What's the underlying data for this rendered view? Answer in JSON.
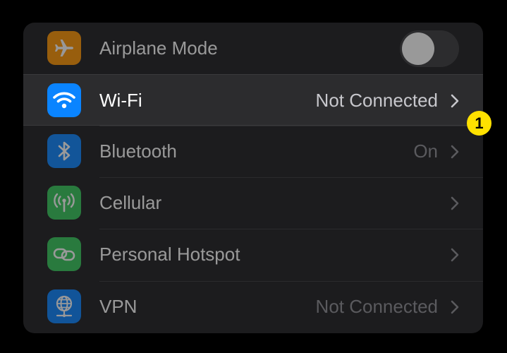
{
  "settings": {
    "rows": [
      {
        "label": "Airplane Mode",
        "icon": "airplane-icon",
        "icon_color": "#ff9500",
        "control": "toggle",
        "toggle_on": false
      },
      {
        "label": "Wi-Fi",
        "icon": "wifi-icon",
        "icon_color": "#0a84ff",
        "value": "Not Connected",
        "control": "chevron"
      },
      {
        "label": "Bluetooth",
        "icon": "bluetooth-icon",
        "icon_color": "#0a84ff",
        "value": "On",
        "control": "chevron"
      },
      {
        "label": "Cellular",
        "icon": "antenna-icon",
        "icon_color": "#34c759",
        "value": "",
        "control": "chevron"
      },
      {
        "label": "Personal Hotspot",
        "icon": "link-icon",
        "icon_color": "#34c759",
        "value": "",
        "control": "chevron"
      },
      {
        "label": "VPN",
        "icon": "globe-network-icon",
        "icon_color": "#0a84ff",
        "value": "Not Connected",
        "control": "chevron"
      }
    ]
  },
  "annotation": {
    "badge": "1",
    "color": "#ffe100"
  }
}
